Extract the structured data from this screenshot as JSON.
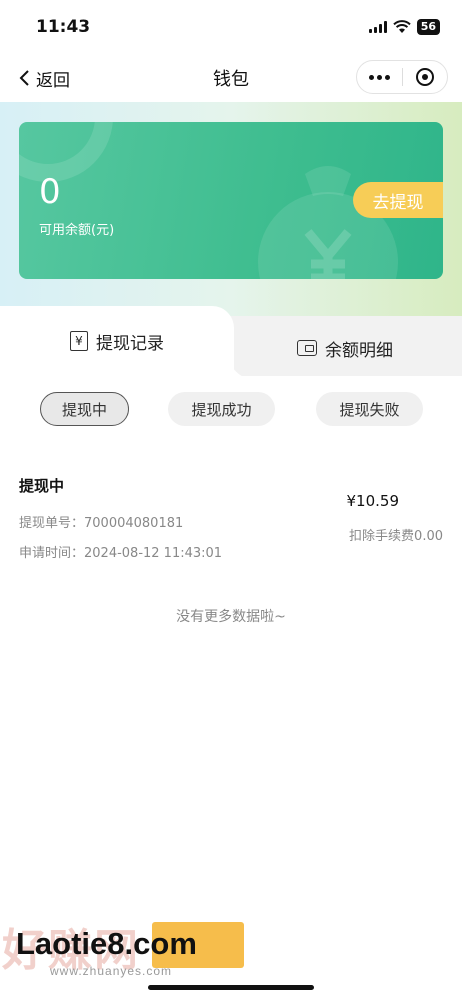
{
  "status_bar": {
    "time": "11:43",
    "battery": "56"
  },
  "nav": {
    "back_label": "返回",
    "title": "钱包"
  },
  "wallet_card": {
    "balance": "0",
    "balance_label": "可用余额(元)",
    "withdraw_label": "去提现"
  },
  "tabs": [
    {
      "label": "提现记录",
      "active": true
    },
    {
      "label": "余额明细",
      "active": false
    }
  ],
  "filters": [
    {
      "label": "提现中",
      "active": true
    },
    {
      "label": "提现成功",
      "active": false
    },
    {
      "label": "提现失败",
      "active": false
    }
  ],
  "records": [
    {
      "status": "提现中",
      "order_no": "提现单号：700004080181",
      "apply_time": "申请时间：2024-08-12 11:43:01",
      "amount": "¥10.59",
      "fee": "扣除手续费0.00"
    }
  ],
  "empty_hint": "没有更多数据啦~",
  "watermark": {
    "main": "Laotie8.com",
    "site": "www.zhuanyes.com",
    "logo_chars": "好赚网"
  },
  "colors": {
    "card_green": "#3ebd8f",
    "withdraw_yellow": "#f7cd57"
  }
}
